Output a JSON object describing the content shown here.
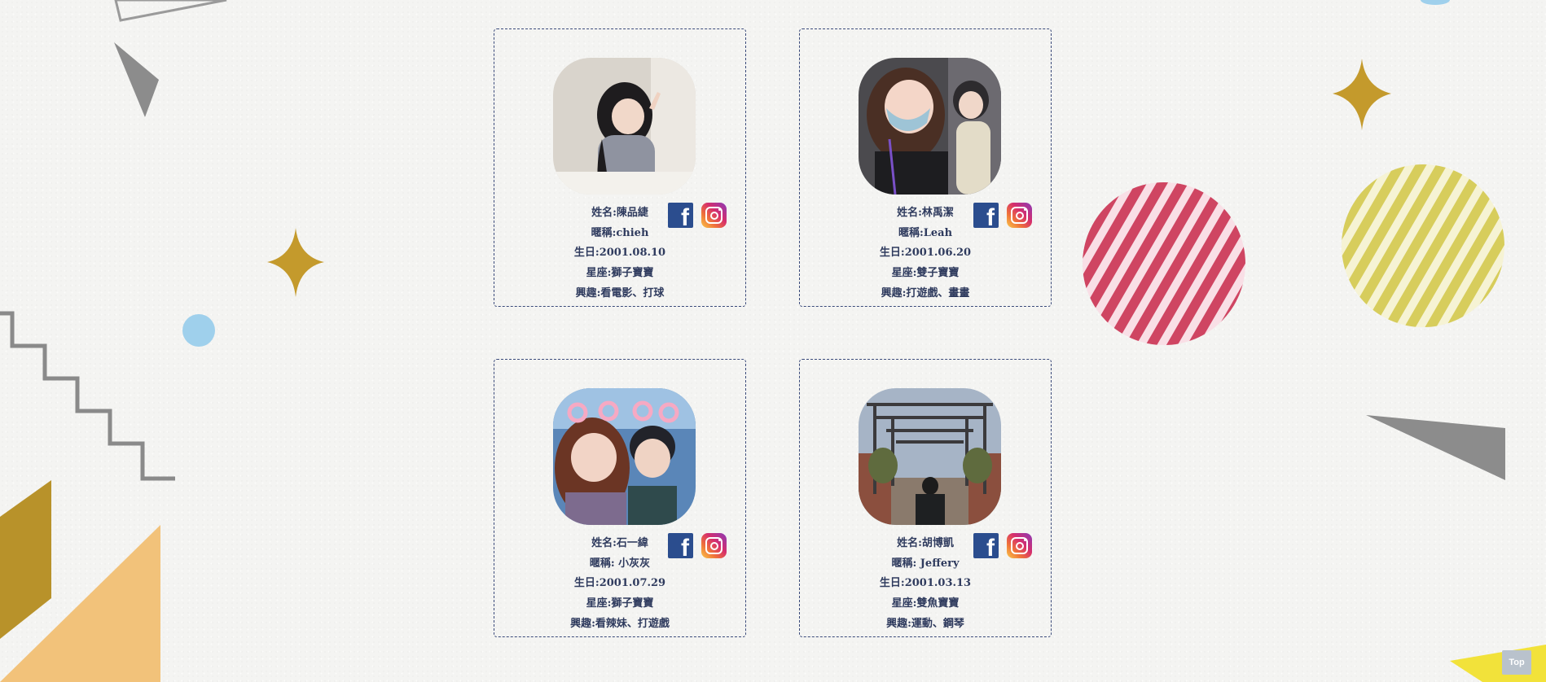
{
  "colors": {
    "card_border": "#3a4a7a",
    "text": "#2f3b5e",
    "facebook": "#2b4d8e",
    "top_button": "#b9c2cc"
  },
  "members": [
    {
      "name": "姓名:陳品緁",
      "nickname": "暱稱:chieh",
      "birthday": "生日:2001.08.10",
      "zodiac": "星座:獅子寶寶",
      "hobby": "興趣:看電影、打球",
      "icons": [
        "facebook-icon",
        "instagram-icon"
      ]
    },
    {
      "name": "姓名:林禹潔",
      "nickname": "暱稱:Leah",
      "birthday": "生日:2001.06.20",
      "zodiac": "星座:雙子寶寶",
      "hobby": "興趣:打遊戲、畫畫",
      "icons": [
        "facebook-icon",
        "instagram-icon"
      ]
    },
    {
      "name": "姓名:石一緯",
      "nickname": "暱稱: 小灰灰",
      "birthday": "生日:2001.07.29",
      "zodiac": "星座:獅子寶寶",
      "hobby": "興趣:看辣妹、打遊戲",
      "icons": [
        "facebook-icon",
        "instagram-icon"
      ]
    },
    {
      "name": "姓名:胡博凱",
      "nickname": "暱稱: Jeffery",
      "birthday": "生日:2001.03.13",
      "zodiac": "星座:雙魚寶寶",
      "hobby": "興趣:運動、鋼琴",
      "icons": [
        "facebook-icon",
        "instagram-icon"
      ]
    }
  ],
  "top_button": {
    "label": "Top"
  }
}
